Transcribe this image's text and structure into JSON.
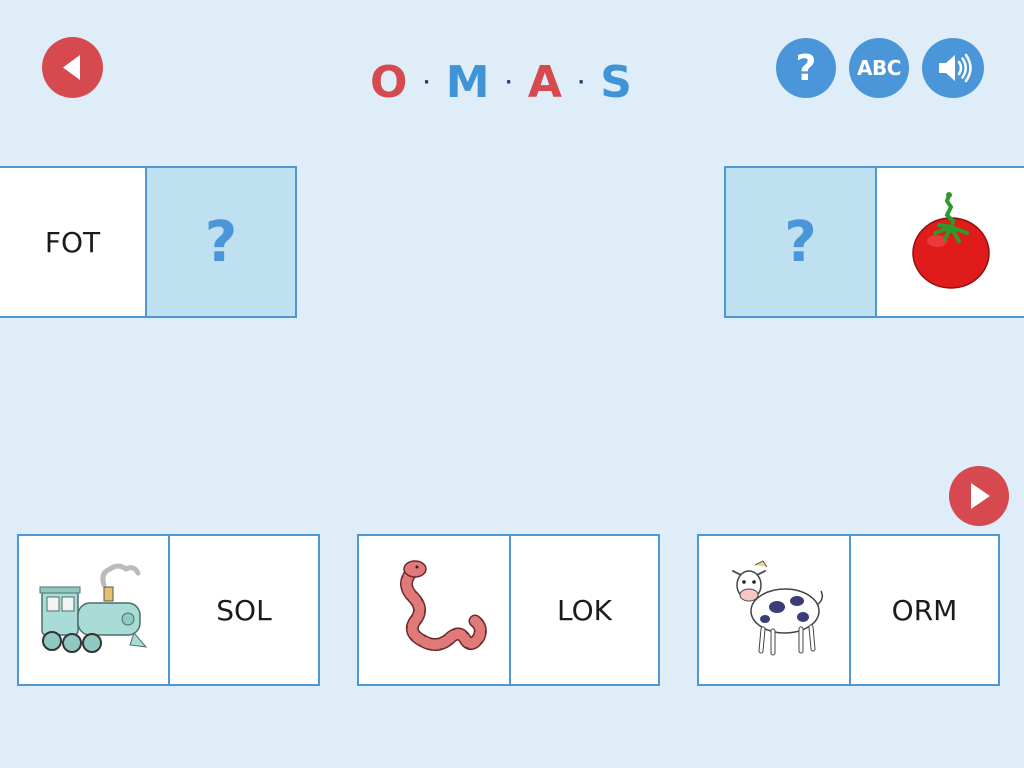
{
  "header": {
    "title_letters": [
      "O",
      "M",
      "A",
      "S"
    ],
    "title_letter_colors": [
      "#d6494f",
      "#3f94d6",
      "#d6494f",
      "#3f94d6"
    ],
    "separator": "·",
    "help_label": "?",
    "abc_label": "ABC",
    "icons": {
      "back": "back-arrow-icon",
      "sound": "speaker-icon",
      "next": "next-arrow-icon"
    }
  },
  "board": {
    "left_domino": {
      "word": "FOT",
      "slot_label": "?"
    },
    "right_domino": {
      "slot_label": "?",
      "picture": "tomato-icon"
    }
  },
  "choices": [
    {
      "picture": "train-icon",
      "word": "SOL"
    },
    {
      "picture": "snake-icon",
      "word": "LOK"
    },
    {
      "picture": "cow-icon",
      "word": "ORM"
    }
  ],
  "colors": {
    "background": "#deedf7",
    "accent_blue": "#4a96d8",
    "accent_red": "#d6494f",
    "slot_fill": "#bfe0f0"
  }
}
